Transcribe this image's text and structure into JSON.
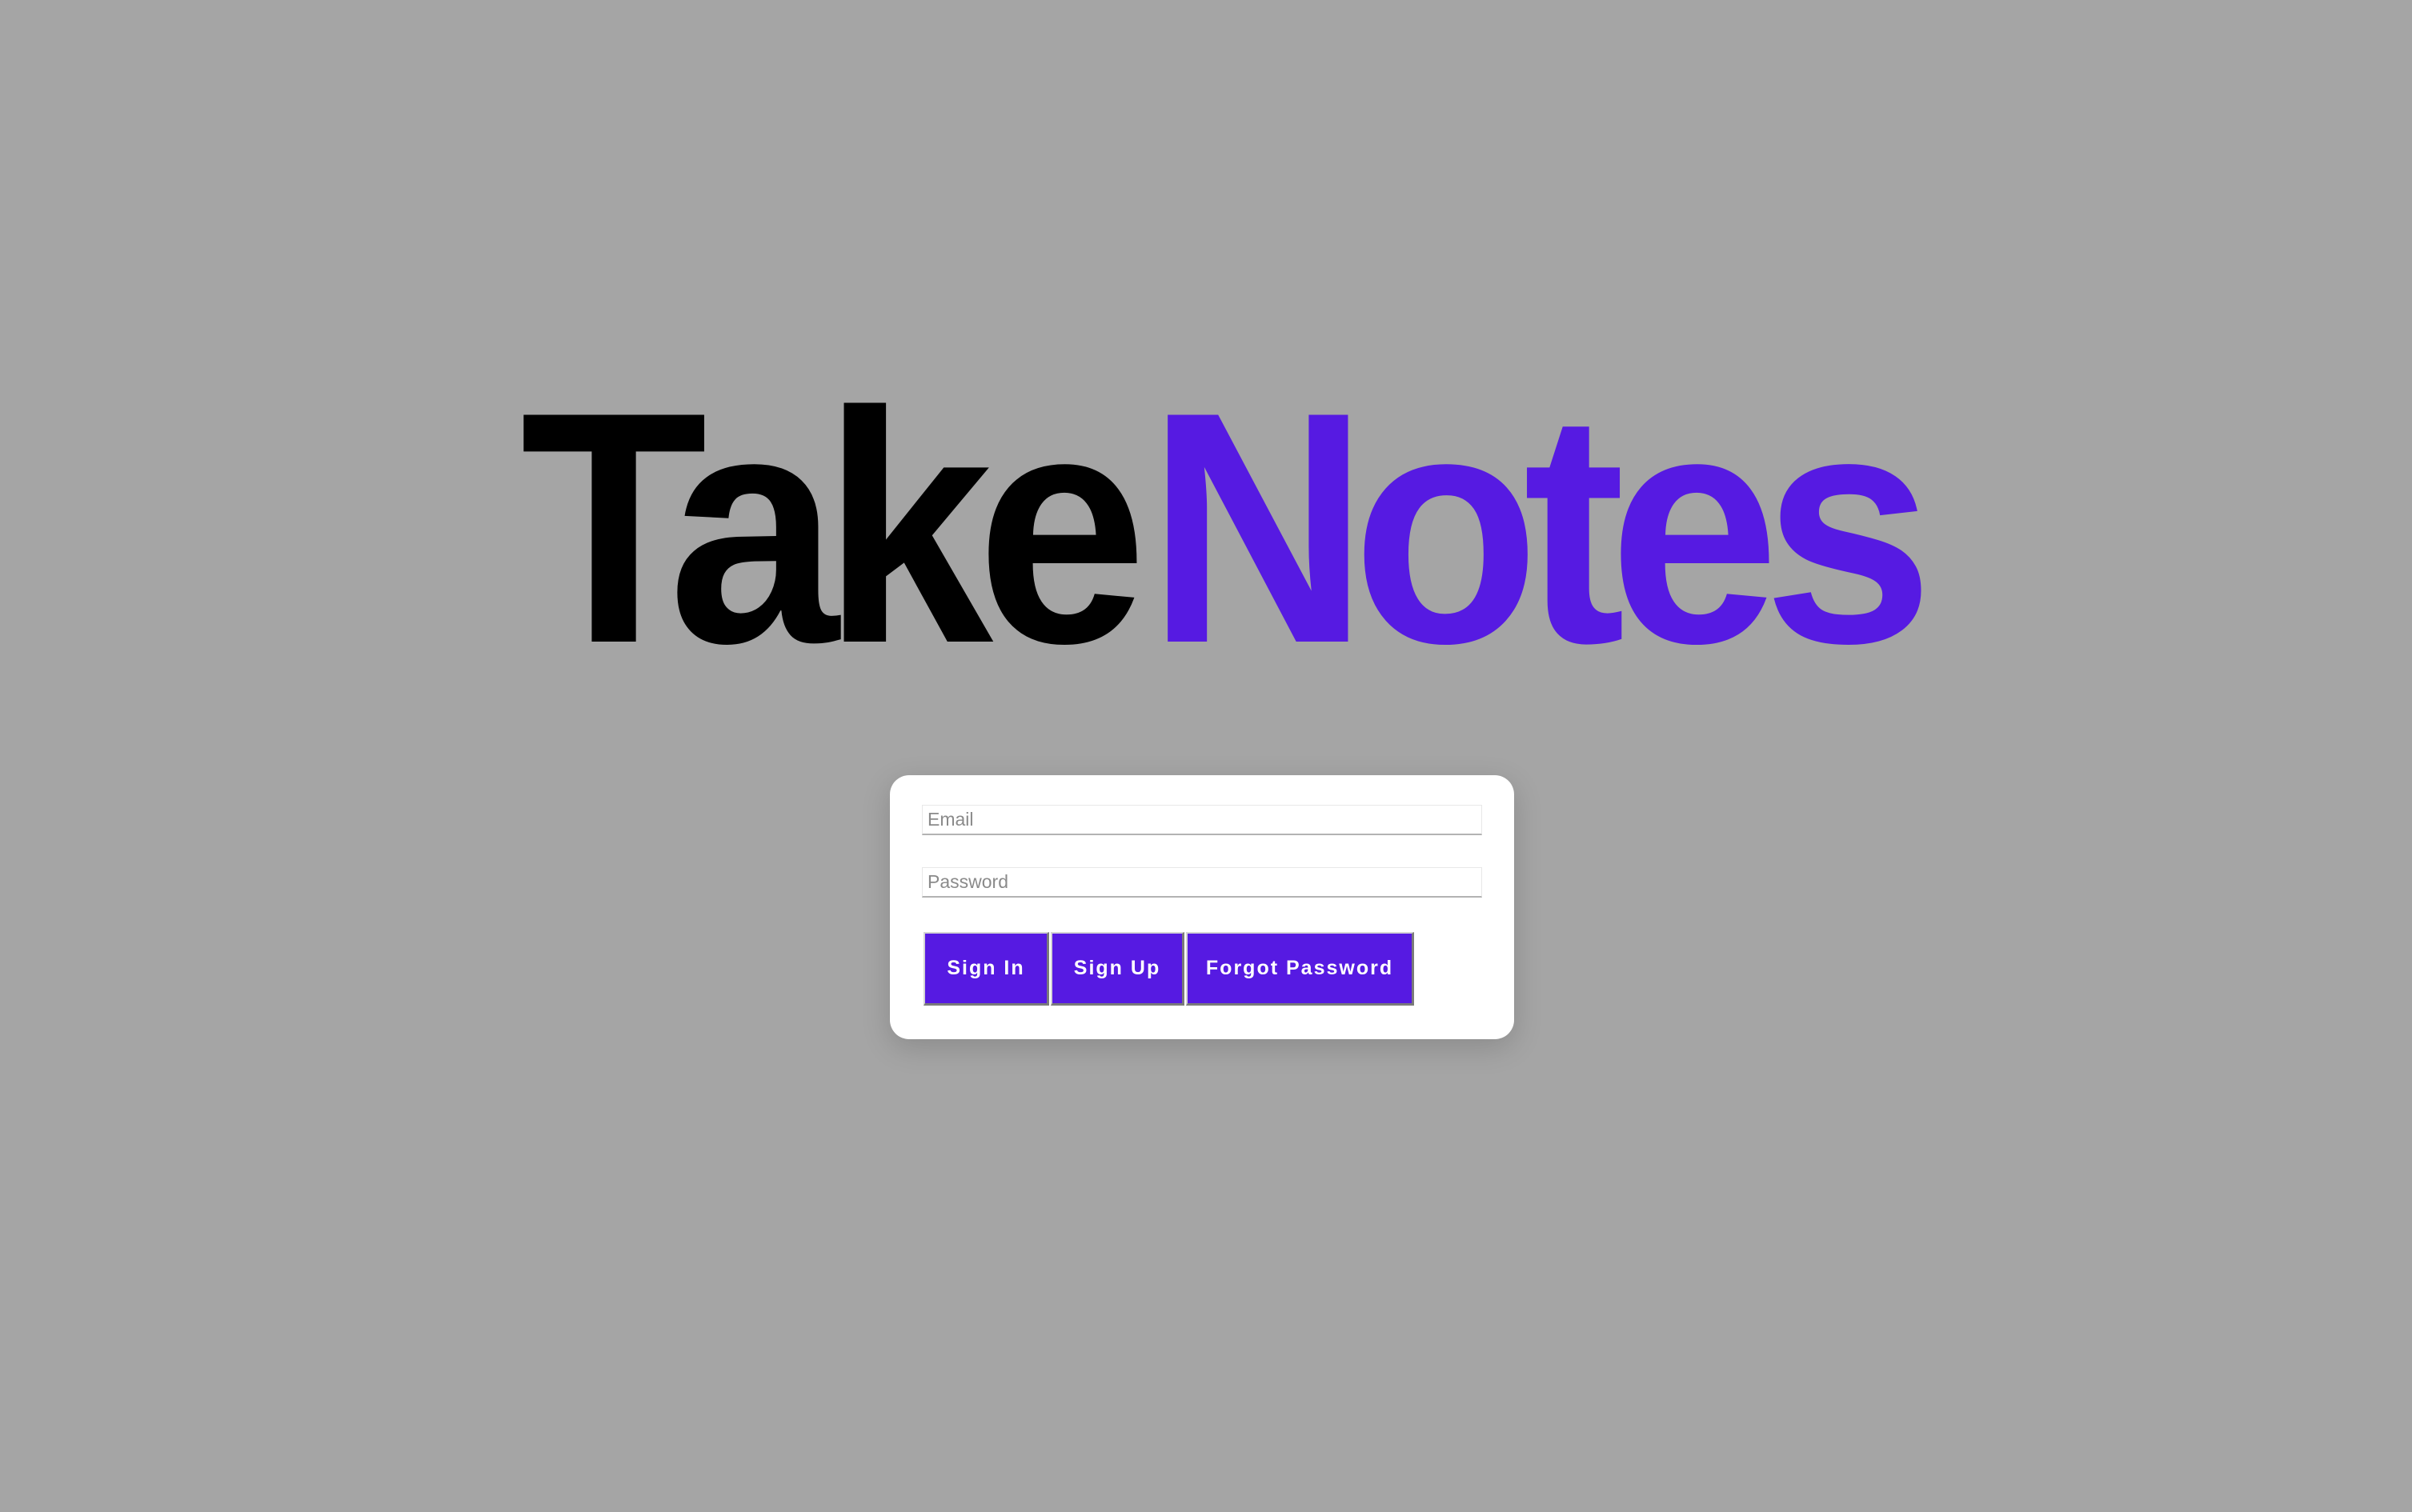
{
  "logo": {
    "part_a": "Take",
    "part_b": "Notes"
  },
  "form": {
    "email_placeholder": "Email",
    "password_placeholder": "Password"
  },
  "buttons": {
    "sign_in": "Sign In",
    "sign_up": "Sign Up",
    "forgot_password": "Forgot Password"
  },
  "colors": {
    "background": "#a5a5a5",
    "accent": "#561ae2",
    "logo_dark": "#000000",
    "card": "#ffffff"
  }
}
